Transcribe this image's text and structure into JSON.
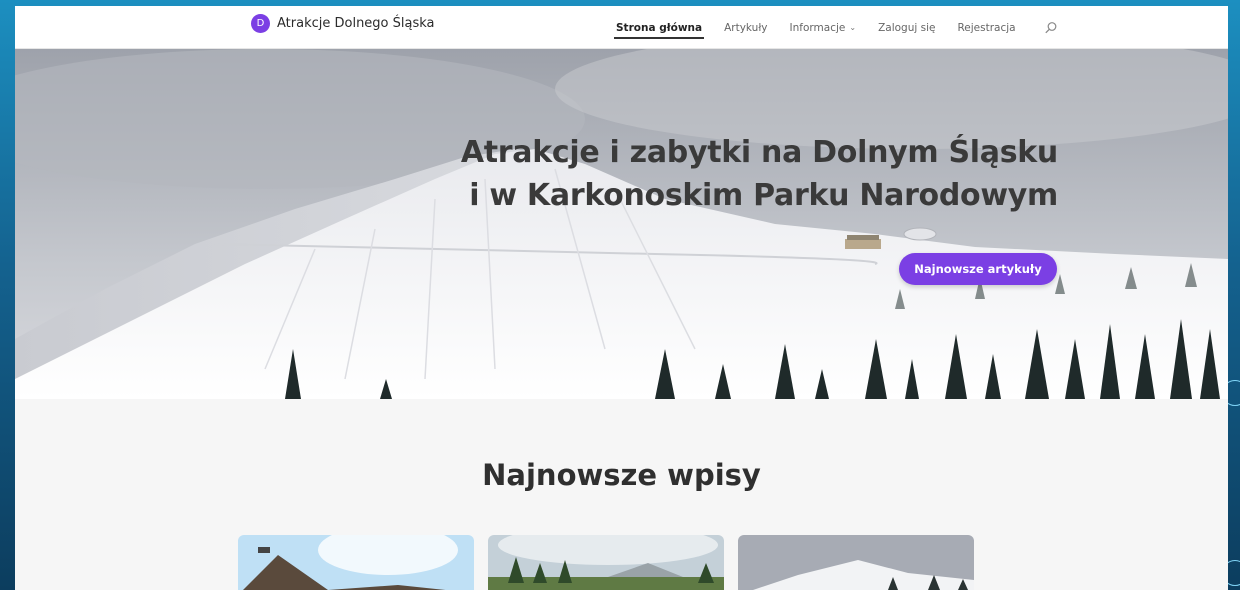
{
  "brand": {
    "badge": "D",
    "name": "Atrakcje Dolnego Śląska"
  },
  "nav": {
    "items": [
      {
        "label": "Strona główna",
        "active": true
      },
      {
        "label": "Artykuły"
      },
      {
        "label": "Informacje",
        "dropdown": true
      },
      {
        "label": "Zaloguj się"
      },
      {
        "label": "Rejestracja"
      }
    ],
    "search_icon": "search-icon"
  },
  "hero": {
    "title_line1": "Atrakcje i zabytki na Dolnym Śląsku",
    "title_line2": "i w Karkonoskim Parku Narodowym",
    "cta_label": "Najnowsze artykuły"
  },
  "latest": {
    "heading": "Najnowsze wpisy",
    "cards": [
      {
        "image": "mountain-slope-sunny"
      },
      {
        "image": "meadow-trees-peak"
      },
      {
        "image": "snowy-mountain"
      }
    ]
  },
  "colors": {
    "accent": "#7b3fe4",
    "navbar_bg": "#ffffff",
    "section_bg": "#f6f6f6"
  }
}
